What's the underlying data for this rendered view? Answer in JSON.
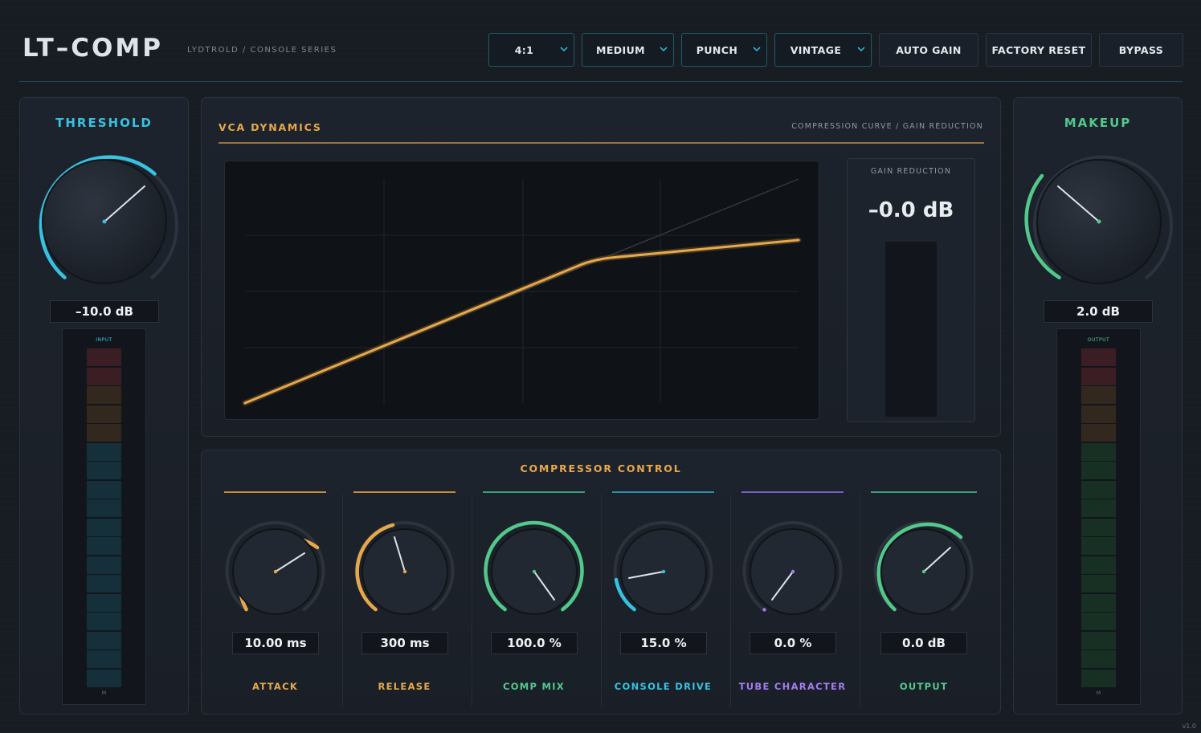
{
  "header": {
    "title": "LT–COMP",
    "subtitle": "LYDTROLD  /  CONSOLE SERIES",
    "dropdowns": [
      {
        "value": "4:1"
      },
      {
        "value": "MEDIUM"
      },
      {
        "value": "PUNCH"
      },
      {
        "value": "VINTAGE"
      }
    ],
    "buttons": {
      "auto_gain": "AUTO GAIN",
      "factory_reset": "FACTORY RESET",
      "bypass": "BYPASS"
    }
  },
  "threshold": {
    "title": "THRESHOLD",
    "value": "–10.0 dB",
    "meter_label": "INPUT",
    "meter_marker": "M",
    "color": "#36c2e0"
  },
  "makeup": {
    "title": "MAKEUP",
    "value": "2.0 dB",
    "meter_label": "OUTPUT",
    "meter_marker": "M",
    "color": "#52c98b"
  },
  "dynamics": {
    "title": "VCA DYNAMICS",
    "subtitle": "COMPRESSION CURVE  /  GAIN REDUCTION",
    "curve_color": "#e7a84a",
    "gain_reduction": {
      "label": "GAIN REDUCTION",
      "value": "–0.0 dB"
    }
  },
  "controls": {
    "title": "COMPRESSOR CONTROL",
    "knobs": [
      {
        "label": "ATTACK",
        "value": "10.00 ms",
        "color": "#e7a84a"
      },
      {
        "label": "RELEASE",
        "value": "300 ms",
        "color": "#e7a84a"
      },
      {
        "label": "COMP MIX",
        "value": "100.0 %",
        "color": "#52c98b"
      },
      {
        "label": "CONSOLE DRIVE",
        "value": "15.0 %",
        "color": "#36c2e0"
      },
      {
        "label": "TUBE CHARACTER",
        "value": "0.0 %",
        "color": "#a27cf0"
      },
      {
        "label": "OUTPUT",
        "value": "0.0 dB",
        "color": "#52c98b"
      }
    ]
  },
  "footer": {
    "version": "v1.0"
  }
}
